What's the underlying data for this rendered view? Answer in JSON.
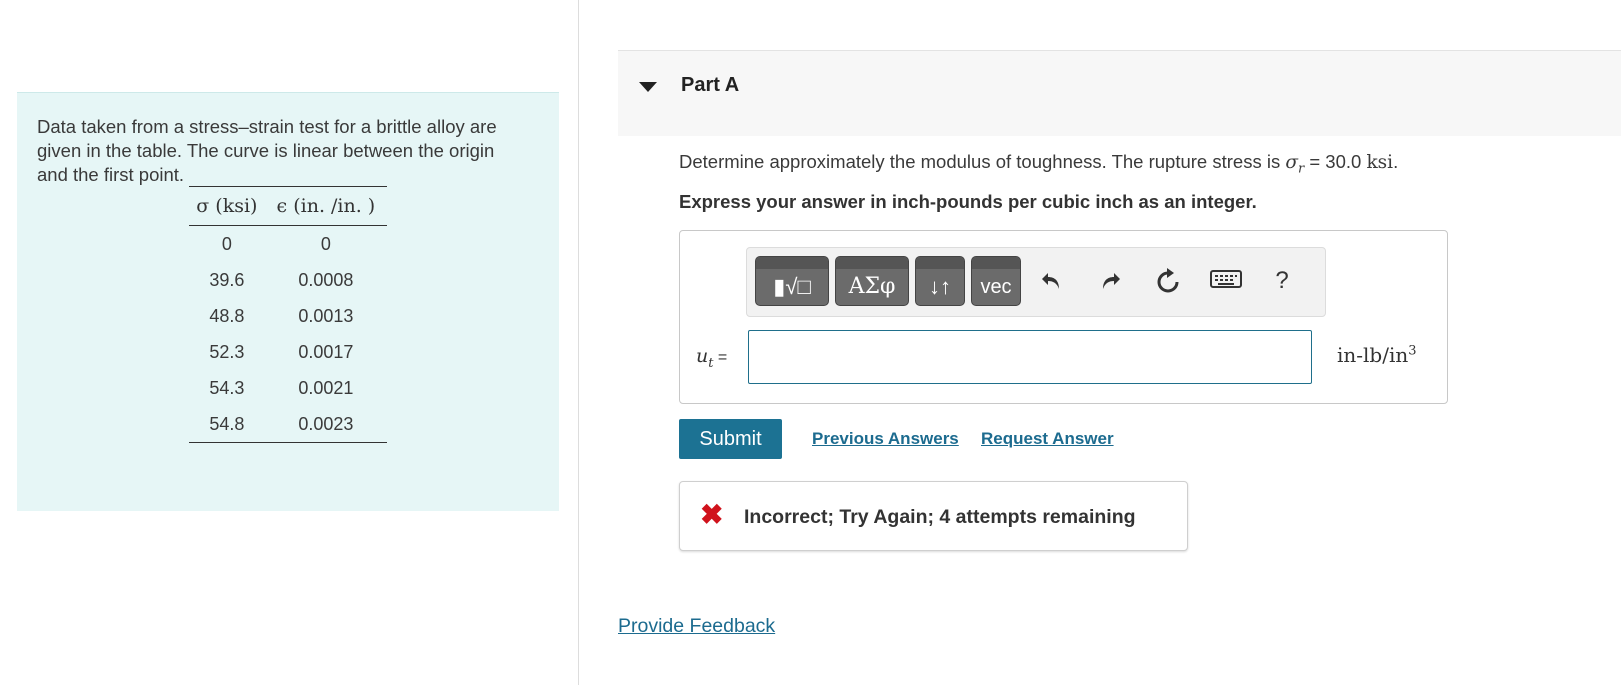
{
  "problem": {
    "intro_text": "Data taken from a stress–strain test for a brittle alloy are given in the table. The curve is linear between the origin and the first point.",
    "table": {
      "headers": [
        "σ (ksi)",
        "ϵ (in. /in. )"
      ],
      "rows": [
        [
          "0",
          "0"
        ],
        [
          "39.6",
          "0.0008"
        ],
        [
          "48.8",
          "0.0013"
        ],
        [
          "52.3",
          "0.0017"
        ],
        [
          "54.3",
          "0.0021"
        ],
        [
          "54.8",
          "0.0023"
        ]
      ]
    }
  },
  "part": {
    "title": "Part A",
    "question_prefix": "Determine approximately the modulus of toughness. The rupture stress is ",
    "sigma_symbol": "σ",
    "sigma_sub": "r",
    "question_value": " = 30.0 ",
    "question_unit": "ksi",
    "question_suffix": ".",
    "instruction": "Express your answer in inch-pounds per cubic inch as an integer."
  },
  "toolbar": {
    "templates_label": "▮√□",
    "greek_label": "ΑΣφ",
    "arrows_label": "↓↑",
    "vec_label": "vec",
    "undo_icon": "undo-icon",
    "redo_icon": "redo-icon",
    "reset_icon": "reset-icon",
    "keyboard_icon": "keyboard-icon",
    "help_label": "?"
  },
  "answer": {
    "var_symbol": "u",
    "var_sub": "t",
    "equals": " =",
    "value": "",
    "units_base": "in-lb/in",
    "units_exp": "3"
  },
  "actions": {
    "submit_label": "Submit",
    "previous_answers_label": "Previous Answers",
    "request_answer_label": "Request Answer"
  },
  "feedback": {
    "status_icon": "x-icon",
    "message": "Incorrect; Try Again; 4 attempts remaining"
  },
  "footer": {
    "provide_feedback_label": "Provide Feedback"
  },
  "colors": {
    "panel_bg": "#e6f6f6",
    "primary": "#1c7293",
    "link": "#1c6b8f",
    "error": "#d0121c"
  }
}
